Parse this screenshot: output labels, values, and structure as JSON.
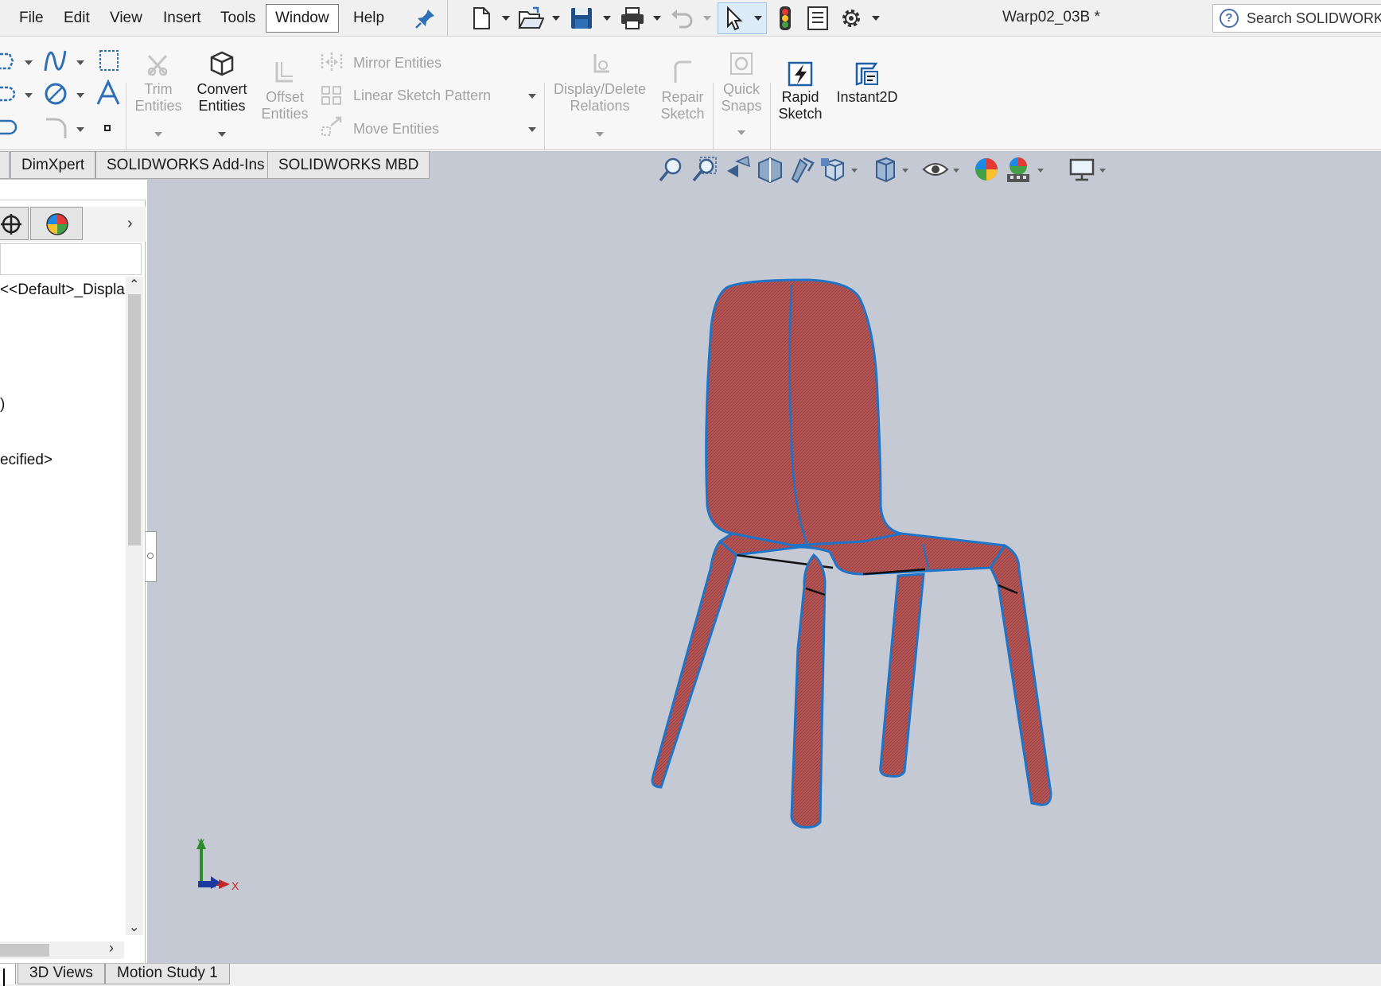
{
  "menu": {
    "items": [
      "File",
      "Edit",
      "View",
      "Insert",
      "Tools",
      "Window",
      "Help"
    ],
    "active_item": "Window"
  },
  "quick_access": {
    "icons": [
      "pin-icon",
      "new-document-icon",
      "open-icon",
      "save-icon",
      "print-icon",
      "undo-icon",
      "select-icon",
      "rebuild-icon",
      "file-properties-icon",
      "options-icon"
    ]
  },
  "document": {
    "title": "Warp02_03B *"
  },
  "search": {
    "placeholder": "Search SOLIDWORKS"
  },
  "ribbon": {
    "trim": {
      "line1": "Trim",
      "line2": "Entities"
    },
    "convert": {
      "line1": "Convert",
      "line2": "Entities"
    },
    "offset": {
      "line1": "Offset",
      "line2": "Entities"
    },
    "mirror": "Mirror Entities",
    "linear_pattern": "Linear Sketch Pattern",
    "move": "Move Entities",
    "display_relations": {
      "line1": "Display/Delete",
      "line2": "Relations"
    },
    "repair": {
      "line1": "Repair",
      "line2": "Sketch"
    },
    "quick_snaps": {
      "line1": "Quick",
      "line2": "Snaps"
    },
    "rapid_sketch": {
      "line1": "Rapid",
      "line2": "Sketch"
    },
    "instant2d": "Instant2D"
  },
  "command_tabs": [
    "DimXpert",
    "SOLIDWORKS Add-Ins",
    "SOLIDWORKS MBD"
  ],
  "feature_tree": {
    "display_state": "<<Default>_Displa",
    "partial_paren": ")",
    "material": "ecified>"
  },
  "bottom_tabs": [
    "3D Views",
    "Motion Study 1"
  ],
  "triad": {
    "x_label": "X",
    "y_label": "Y"
  },
  "colors": {
    "viewport_bg": "#c4c9d4",
    "chair_fill": "#b75656",
    "chair_edge": "#1f74c8",
    "accent_blue": "#1f74c8"
  }
}
